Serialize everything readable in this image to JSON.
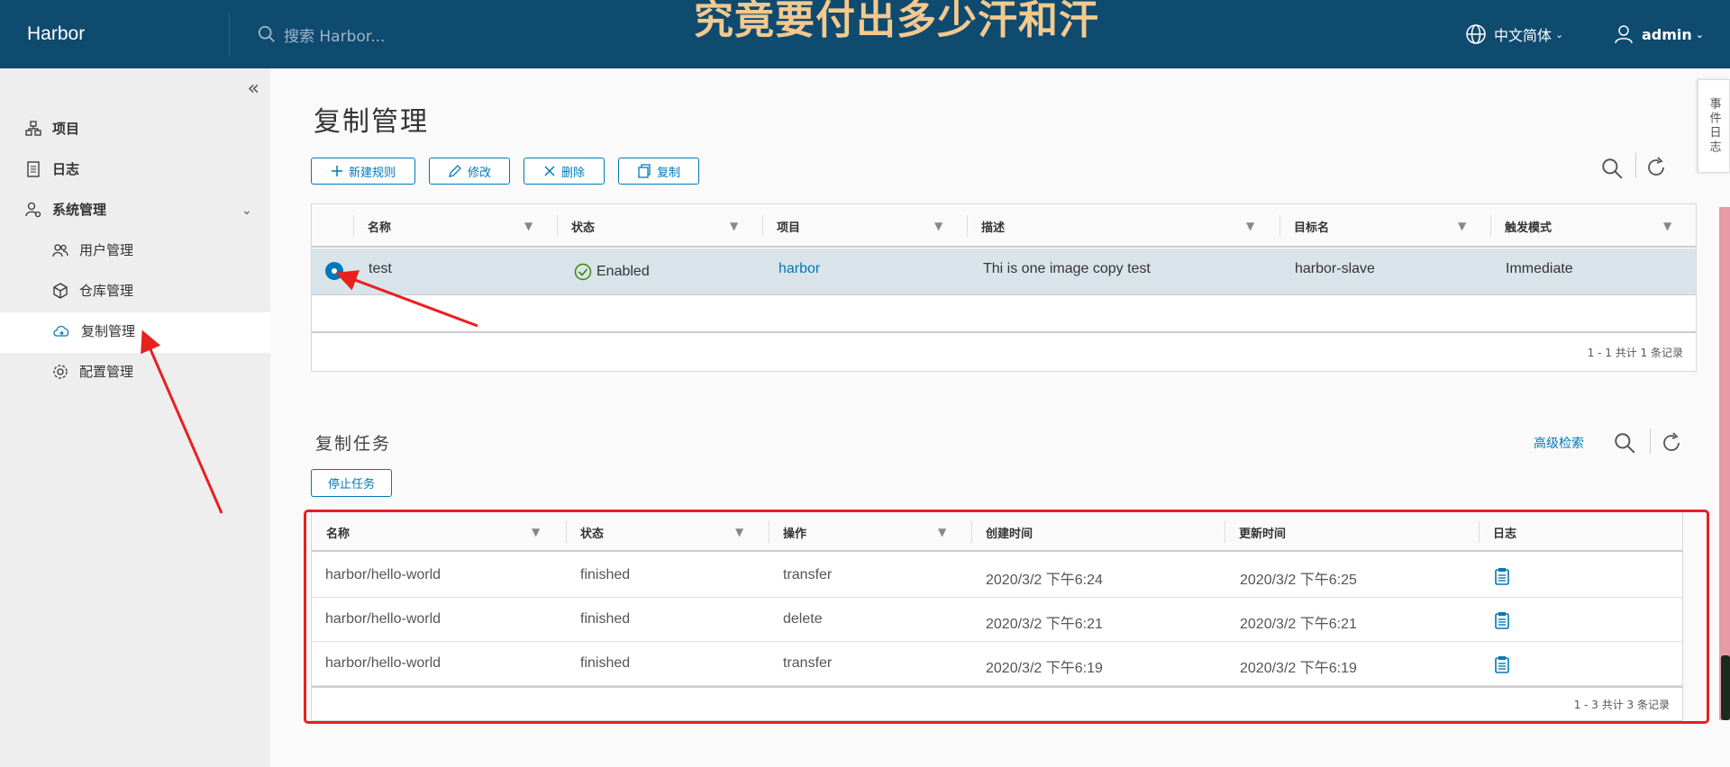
{
  "header": {
    "brand": "Harbor",
    "search_placeholder": "搜索 Harbor...",
    "overlay_text": "究竟要付出多少汗和汗",
    "language": "中文简体",
    "user": "admin"
  },
  "sidebar": {
    "items": [
      {
        "label": "项目",
        "icon": "project-icon"
      },
      {
        "label": "日志",
        "icon": "log-icon"
      },
      {
        "label": "系统管理",
        "icon": "admin-icon"
      },
      {
        "label": "用户管理",
        "icon": "users-icon"
      },
      {
        "label": "仓库管理",
        "icon": "registry-icon"
      },
      {
        "label": "复制管理",
        "icon": "cloud-icon",
        "active": true
      },
      {
        "label": "配置管理",
        "icon": "gear-icon"
      }
    ]
  },
  "main": {
    "title": "复制管理",
    "toolbar": {
      "new_rule": "新建规则",
      "edit": "修改",
      "delete": "删除",
      "replicate": "复制"
    },
    "rules_table": {
      "columns": [
        "名称",
        "状态",
        "项目",
        "描述",
        "目标名",
        "触发模式"
      ],
      "rows": [
        {
          "name": "test",
          "status": "Enabled",
          "project": "harbor",
          "description": "Thi is one image copy test",
          "target": "harbor-slave",
          "trigger": "Immediate"
        }
      ],
      "footer": "1 - 1 共计 1 条记录"
    },
    "jobs": {
      "title": "复制任务",
      "advanced_search": "高级检索",
      "stop_button": "停止任务",
      "columns": [
        "名称",
        "状态",
        "操作",
        "创建时间",
        "更新时间",
        "日志"
      ],
      "rows": [
        {
          "name": "harbor/hello-world",
          "status": "finished",
          "operation": "transfer",
          "created": "2020/3/2 下午6:24",
          "updated": "2020/3/2 下午6:25"
        },
        {
          "name": "harbor/hello-world",
          "status": "finished",
          "operation": "delete",
          "created": "2020/3/2 下午6:21",
          "updated": "2020/3/2 下午6:21"
        },
        {
          "name": "harbor/hello-world",
          "status": "finished",
          "operation": "transfer",
          "created": "2020/3/2 下午6:19",
          "updated": "2020/3/2 下午6:19"
        }
      ],
      "footer": "1 - 3 共计 3 条记录"
    }
  },
  "event_log_tab": "事件日志",
  "colors": {
    "header": "#0f4a6f",
    "accent": "#0079b8",
    "highlight": "#e8201f",
    "overlay_text": "#f4c98e"
  }
}
